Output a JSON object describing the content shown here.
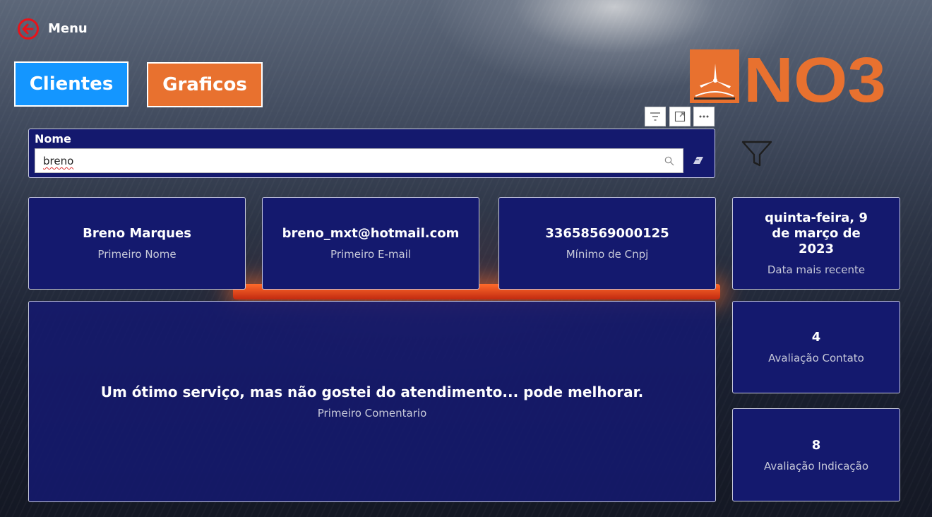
{
  "nav": {
    "menu_label": "Menu"
  },
  "buttons": {
    "clientes": "Clientes",
    "graficos": "Graficos"
  },
  "logo": {
    "text": "NO3",
    "brand_color": "#e8712f"
  },
  "slicer": {
    "title": "Nome",
    "search_value": "breno"
  },
  "cards": {
    "primeiro_nome": {
      "value": "Breno Marques",
      "label": "Primeiro Nome"
    },
    "primeiro_email": {
      "value": "breno_mxt@hotmail.com",
      "label": "Primeiro E-mail"
    },
    "minimo_cnpj": {
      "value": "33658569000125",
      "label": "Mínimo de Cnpj"
    },
    "data_recente": {
      "value": "quinta-feira, 9 de março de 2023",
      "label": "Data mais recente"
    },
    "comentario": {
      "value": "Um ótimo serviço, mas não gostei do atendimento... pode melhorar.",
      "label": "Primeiro Comentario"
    },
    "avaliacao_contato": {
      "value": "4",
      "label": "Avaliação Contato"
    },
    "avaliacao_indicacao": {
      "value": "8",
      "label": "Avaliação Indicação"
    }
  },
  "colors": {
    "card_bg": "#14196e",
    "clientes_btn": "#1496ff",
    "graficos_btn": "#e8712f",
    "back_icon": "#e8131a"
  }
}
